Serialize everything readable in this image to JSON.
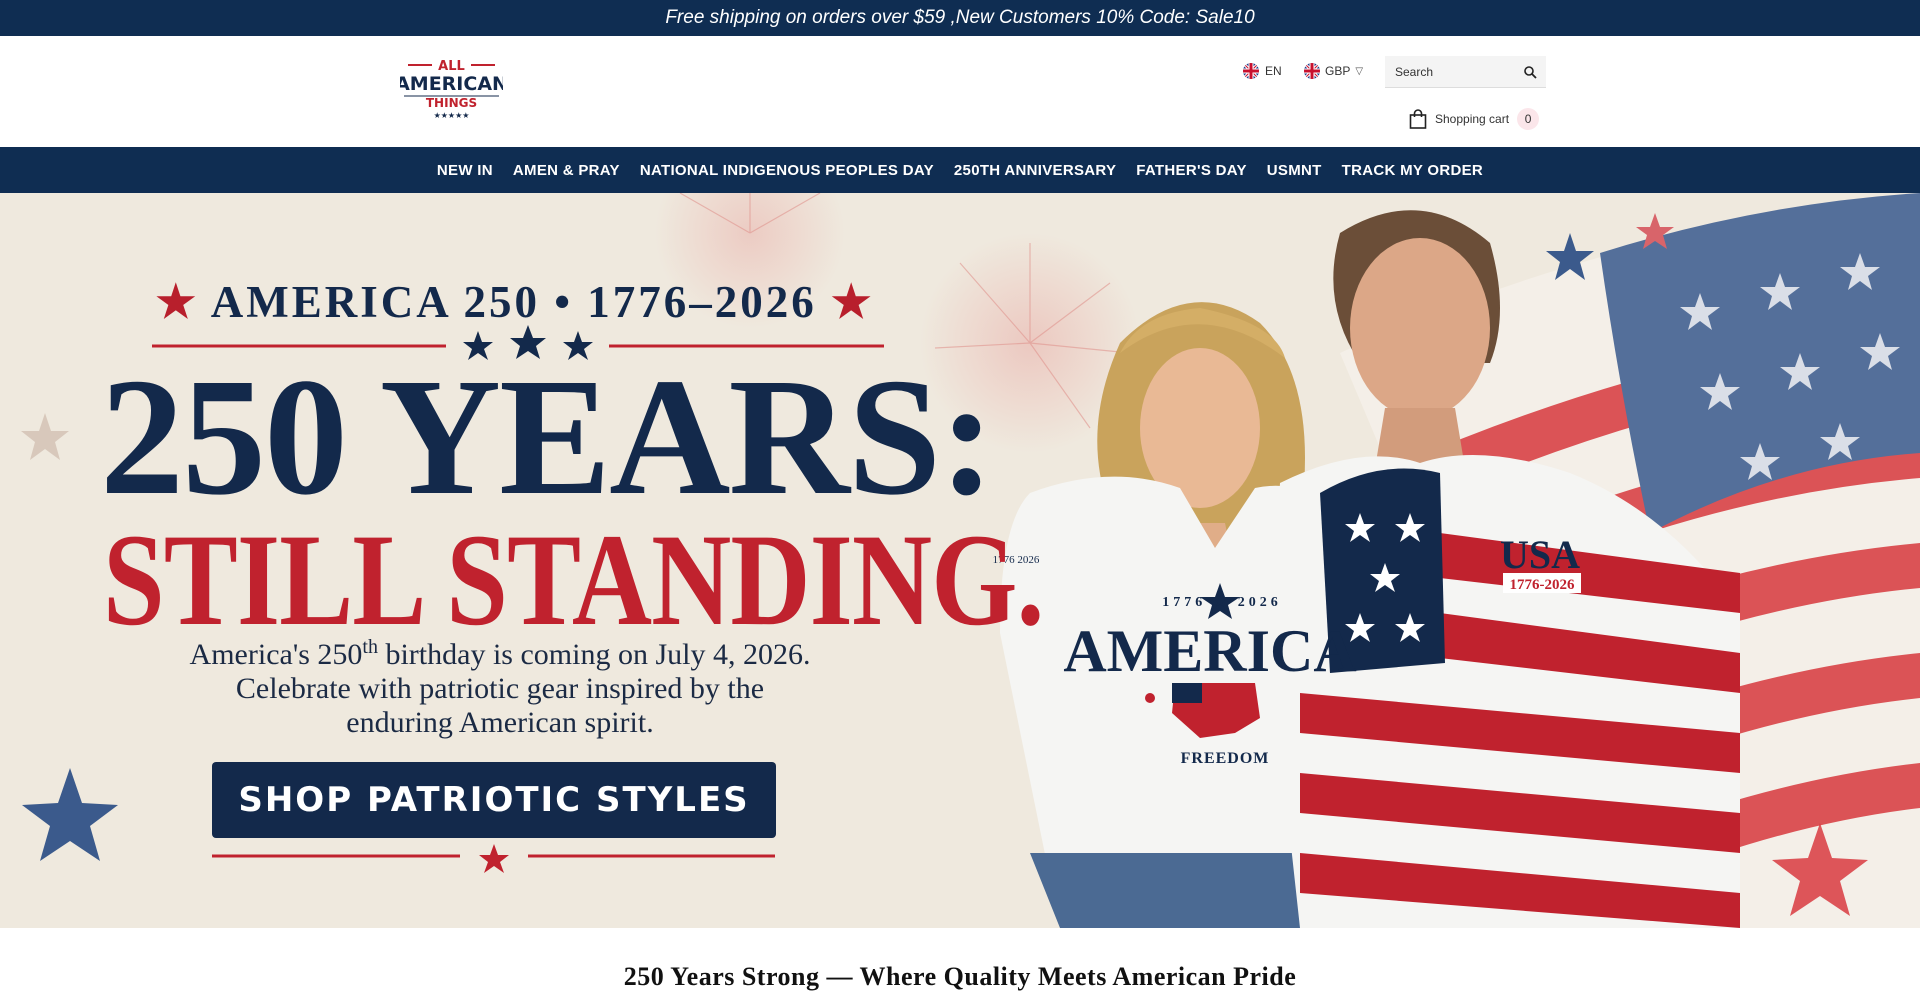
{
  "announcement": {
    "text": "Free shipping on orders over $59 ,New Customers 10% Code: Sale10"
  },
  "header": {
    "logo": {
      "line1": "ALL",
      "line2": "AMERICAN",
      "line3": "THINGS",
      "stars": "★★★★★"
    },
    "language": "EN",
    "currency": "GBP",
    "search": {
      "placeholder": "Search"
    },
    "cart": {
      "label": "Shopping cart",
      "count": "0"
    }
  },
  "nav": {
    "items": [
      {
        "label": "NEW IN"
      },
      {
        "label": "AMEN & PRAY"
      },
      {
        "label": "NATIONAL INDIGENOUS PEOPLES DAY"
      },
      {
        "label": "250TH ANNIVERSARY"
      },
      {
        "label": "FATHER'S DAY"
      },
      {
        "label": "USMNT"
      },
      {
        "label": "TRACK MY ORDER"
      }
    ]
  },
  "hero": {
    "eyebrow": "AMERICA 250 • 1776–2026",
    "title_line1": "250 YEARS:",
    "title_line2": "STILL STANDING.",
    "subtitle_a": "America's 250",
    "subtitle_sup": "th",
    "subtitle_b": " birthday is coming on July 4, 2026.",
    "subtitle_line2": "Celebrate with patriotic gear inspired by the",
    "subtitle_line3": "enduring American spirit.",
    "cta": "SHOP PATRIOTIC STYLES",
    "shirt_woman": {
      "years": "1776 ★ 2026",
      "word": "AMERICA",
      "footer": "FREEDOM",
      "sleeve": "1776 2026"
    },
    "shirt_man": {
      "word": "USA",
      "years": "1776-2026"
    }
  },
  "section": {
    "tagline": "250 Years Strong — Where Quality Meets American Pride"
  },
  "colors": {
    "navy": "#0f2d52",
    "red": "#c0222e",
    "cream": "#efe9de"
  }
}
